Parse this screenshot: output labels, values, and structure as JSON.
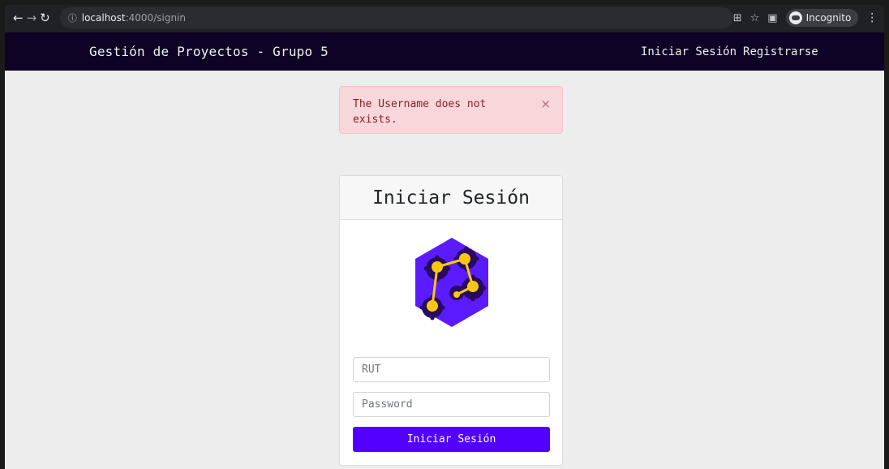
{
  "browser": {
    "url_host": "localhost",
    "url_path": ":4000/signin",
    "incognito_label": "Incognito"
  },
  "navbar": {
    "brand": "Gestión de Proyectos - Grupo 5",
    "links": [
      "Iniciar Sesión",
      "Registrarse"
    ]
  },
  "alert": {
    "message": "The Username does not exists.",
    "close_glyph": "×"
  },
  "card": {
    "title": "Iniciar Sesión",
    "rut_placeholder": "RUT",
    "password_placeholder": "Password",
    "submit_label": "Iniciar Sesión"
  },
  "colors": {
    "navbar_bg": "#0e0225",
    "accent": "#5200ff",
    "logo_hex": "#5b1bff",
    "logo_nodes": "#f9c80e"
  }
}
